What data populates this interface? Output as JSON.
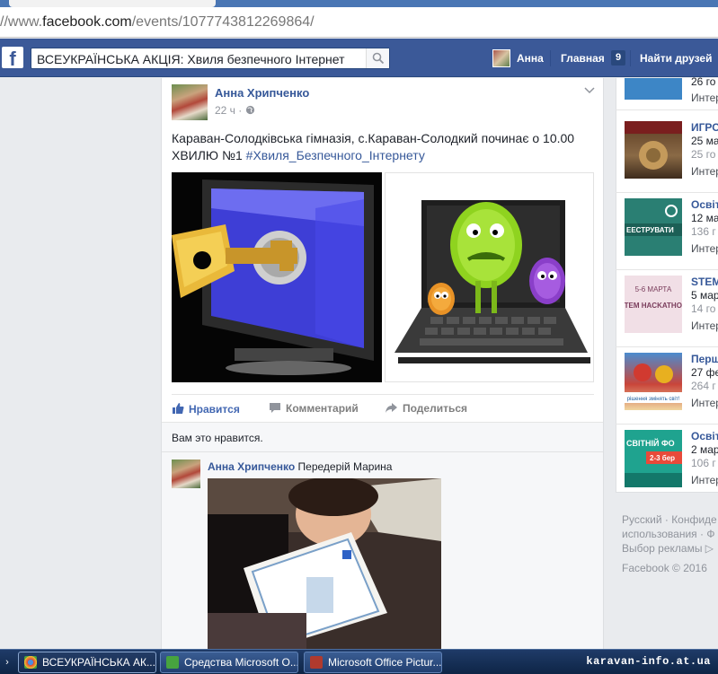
{
  "browser": {
    "url_prefix": "//www.",
    "url_domain": "facebook.com",
    "url_path": "/events/1077743812269864/"
  },
  "fb_header": {
    "search_value": "ВСЕУКРАЇНСЬКА АКЦІЯ: Хвиля безпечного Інтернет",
    "user_name": "Анна",
    "home_label": "Главная",
    "home_badge": "9",
    "find_friends_label": "Найти друзей"
  },
  "post": {
    "author": "Анна Хрипченко",
    "time": "22 ч",
    "meta_separator": "·",
    "text": "Караван-Солодківська гімназія, с.Караван-Солодкий починає о 10.00 ХВИЛЮ №1 ",
    "hashtag": "#Хвиля_Безпечного_Інтернету",
    "actions": {
      "like": "Нравится",
      "comment": "Комментарий",
      "share": "Поделиться"
    },
    "likes_text": "Вам это нравится.",
    "comment": {
      "author": "Анна Хрипченко",
      "tagged": "Передерій Марина"
    }
  },
  "events": [
    {
      "title": "",
      "line2": "26 го",
      "line3": "",
      "line4": "Интер",
      "thumb_color": "#3d86c6"
    },
    {
      "title": "ИГРО",
      "line2": "25 ма",
      "line3": "25 го",
      "line4": "Интер",
      "thumb_color": "#6b4a2e"
    },
    {
      "title": "Освіт",
      "line2": "12 ма",
      "line3": "136 г",
      "line4": "Интер",
      "thumb_color": "#2a7f73",
      "thumb_text": "ЕЕСТРУВАТИ"
    },
    {
      "title": "STEM",
      "line2": "5 мар",
      "line3": "14 го",
      "line4": "Интер",
      "thumb_color": "#f1dfe6",
      "thumb_text_top": "5-6 МАРТА",
      "thumb_text": "STEM HACKATHON"
    },
    {
      "title": "Перш",
      "line2": "27 фе",
      "line3": "264 г",
      "line4": "Интер",
      "thumb_color": "#c9453a",
      "thumb_text": "рішення змінять світ!"
    },
    {
      "title": "Освіт",
      "line2": "2 мар",
      "line3": "106 г",
      "line4": "Интер",
      "thumb_color": "#1fa38f",
      "thumb_text": "СВІТНІЙ ФО",
      "thumb_text_bottom": "2-3 бер"
    }
  ],
  "footer": {
    "line1": "Русский · Конфиде",
    "line2": "использования · Ф",
    "line3": "Выбор рекламы ▷",
    "copyright": "Facebook © 2016"
  },
  "taskbar": {
    "start_glyph": "›",
    "items": [
      {
        "label": "ВСЕУКРАЇНСЬКА АК...",
        "icon_color": "#d9453b"
      },
      {
        "label": "Средства Microsoft O...",
        "icon_color": "#47a33f"
      },
      {
        "label": "Microsoft Office Pictur...",
        "icon_color": "#b03a2e"
      }
    ],
    "watermark": "karavan-info.at.ua"
  },
  "colors": {
    "fb_blue": "#3b5998",
    "link_blue": "#365899",
    "page_bg": "#e9ebee"
  }
}
